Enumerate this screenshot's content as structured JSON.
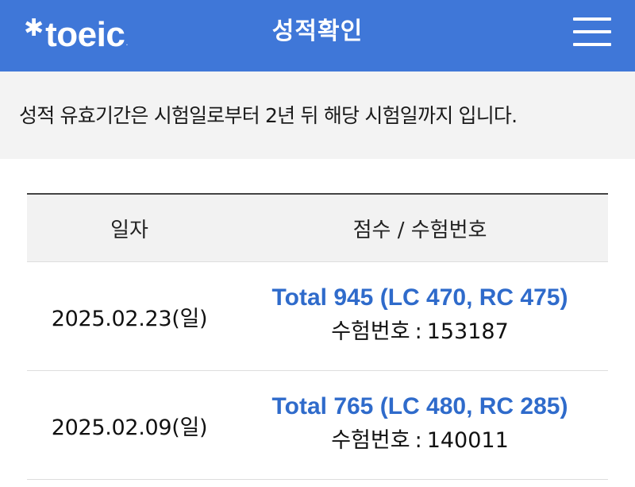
{
  "header": {
    "logo_text": "toeic",
    "logo_mark": "✱",
    "logo_registered": ".",
    "title": "성적확인",
    "menu_icon": "hamburger-menu-icon"
  },
  "notice": {
    "text": "성적 유효기간은 시험일로부터 2년 뒤 해당 시험일까지 입니다."
  },
  "table": {
    "headers": [
      "일자",
      "점수 / 수험번호"
    ],
    "rows": [
      {
        "date": "2025.02.23(일)",
        "score": "Total 945 (LC 470, RC 475)",
        "exam_label": "수험번호",
        "exam_sep": ":",
        "exam_number": "153187"
      },
      {
        "date": "2025.02.09(일)",
        "score": "Total 765 (LC 480, RC 285)",
        "exam_label": "수험번호",
        "exam_sep": ":",
        "exam_number": "140011"
      }
    ]
  },
  "colors": {
    "header_bg": "#3f77d8",
    "score_link": "#2f6bcb",
    "notice_bg": "#f3f3f3",
    "table_header_bg": "#f2f2f2"
  }
}
